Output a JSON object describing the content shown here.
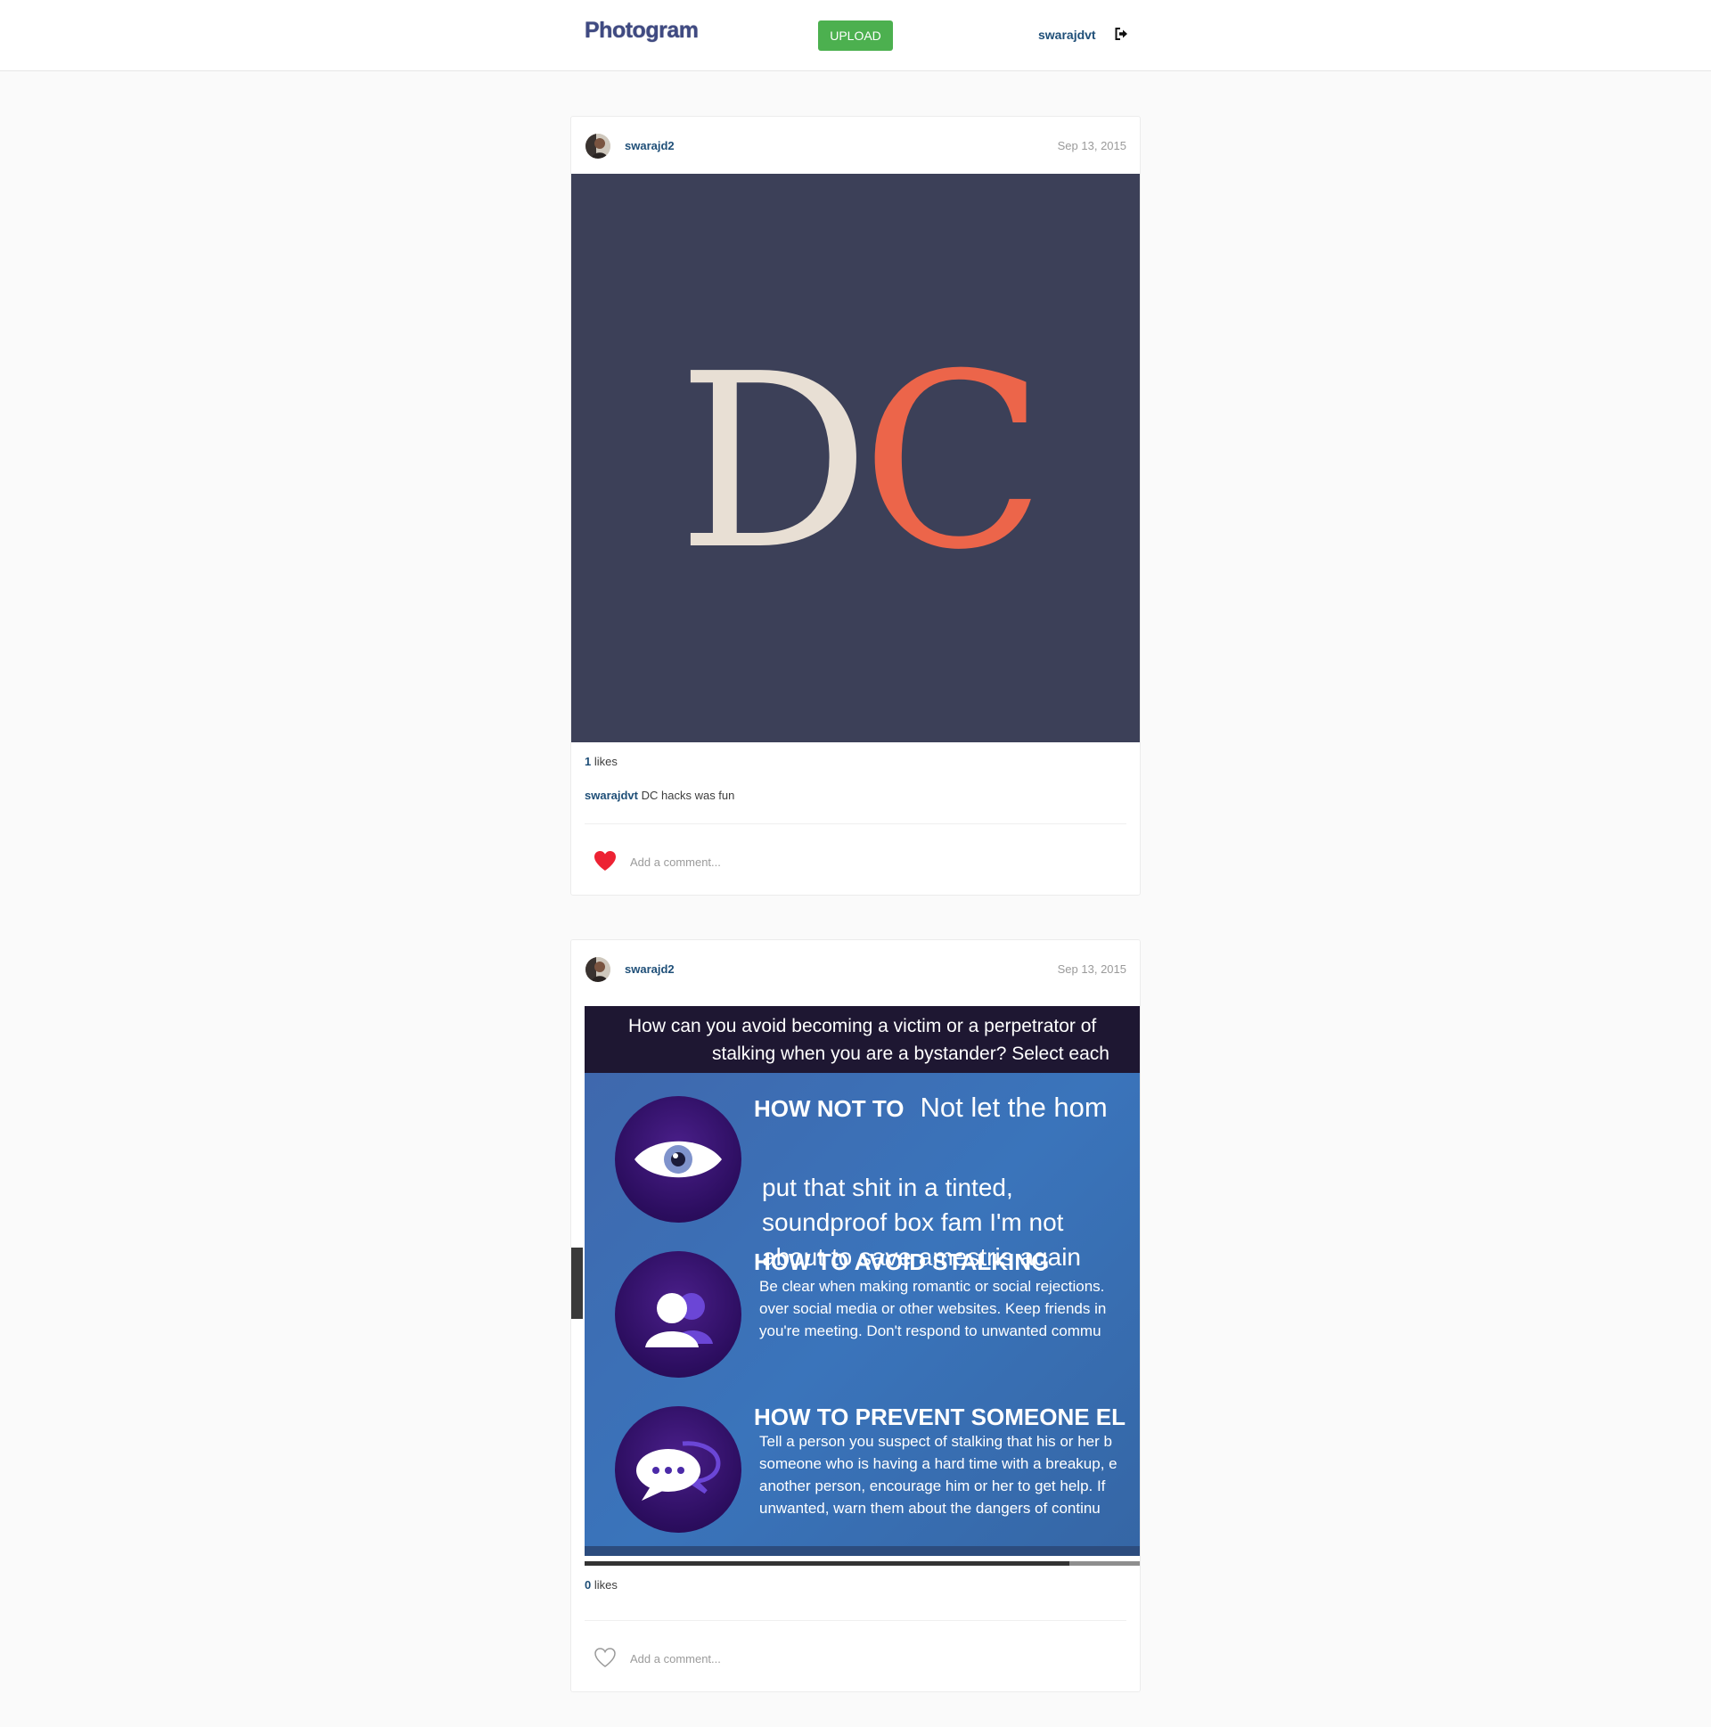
{
  "header": {
    "logo": "Photogram",
    "upload_label": "UPLOAD",
    "username": "swarajdvt",
    "icons": {
      "logout": "logout-icon"
    },
    "colors": {
      "upload": "#4cb04f",
      "logo": "#3f4a82",
      "link": "#1f4f78"
    }
  },
  "posts": [
    {
      "user": "swarajd2",
      "date": "Sep 13, 2015",
      "image": {
        "letters": [
          "D",
          "C"
        ],
        "colors": {
          "background": "#3c4058",
          "d": "#e8dfd4",
          "c": "#ec654a"
        }
      },
      "likes": {
        "count": "1",
        "label": "likes"
      },
      "caption": {
        "user": "swarajdvt",
        "text": "DC hacks was fun"
      },
      "liked": true,
      "comment_placeholder": "Add a comment..."
    },
    {
      "user": "swarajd2",
      "date": "Sep 13, 2015",
      "image": {
        "header_line1": "How can you avoid becoming a victim or a perpetrator of",
        "header_line2": "stalking when you are a bystander? Select each",
        "sections": [
          {
            "title": "HOW NOT TO",
            "title_extra": "Not let the hom",
            "icon": "eye-icon",
            "text": "put that shit in a tinted,\nsoundproof box fam I'm not\nabout to save amestris again"
          },
          {
            "title": "HOW TO AVOID STALKING",
            "icon": "users-icon",
            "text": "Be clear when making romantic or social rejections.\nover social media or other websites. Keep friends in\nyou're meeting. Don't respond to unwanted commu"
          },
          {
            "title": "HOW TO PREVENT SOMEONE EL",
            "icon": "chat-bubble-icon",
            "text": "Tell a person you suspect of stalking that his or her b\nsomeone who is having a hard time with a breakup, e\nanother person, encourage him or her to get help. If\nunwanted, warn them about the dangers of continu"
          }
        ],
        "playback_progress": 0.873
      },
      "likes": {
        "count": "0",
        "label": "likes"
      },
      "liked": false,
      "comment_placeholder": "Add a comment..."
    }
  ]
}
